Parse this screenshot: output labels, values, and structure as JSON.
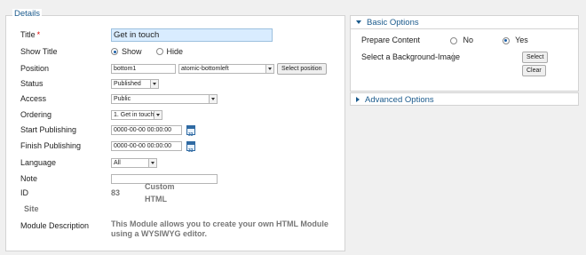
{
  "details": {
    "legend": "Details",
    "title": {
      "label": "Title",
      "required": "*",
      "value": "Get in touch"
    },
    "show_title": {
      "label": "Show Title",
      "options": [
        "Show",
        "Hide"
      ],
      "selected": "Show"
    },
    "position": {
      "label": "Position",
      "value": "bottom1",
      "select_value": "atomic-bottomleft",
      "button": "Select position"
    },
    "status": {
      "label": "Status",
      "value": "Published"
    },
    "access": {
      "label": "Access",
      "value": "Public"
    },
    "ordering": {
      "label": "Ordering",
      "value": "1. Get in touch"
    },
    "start_publishing": {
      "label": "Start Publishing",
      "value": "0000-00-00 00:00:00",
      "cal": "33"
    },
    "finish_publishing": {
      "label": "Finish Publishing",
      "value": "0000-00-00 00:00:00",
      "cal": "33"
    },
    "language": {
      "label": "Language",
      "value": "All"
    },
    "note": {
      "label": "Note",
      "value": ""
    },
    "id": {
      "label": "ID",
      "value": "83",
      "type": "Custom HTML"
    },
    "site": {
      "label": "Site"
    },
    "module_description": {
      "label": "Module Description",
      "value": "This Module allows you to create your own HTML Module using a WYSIWYG editor."
    }
  },
  "basic_options": {
    "title": "Basic Options",
    "prepare_content": {
      "label": "Prepare Content",
      "options": [
        "No",
        "Yes"
      ],
      "selected": "Yes"
    },
    "background_image": {
      "label": "Select a Background-Image",
      "select_button": "Select",
      "clear_button": "Clear"
    }
  },
  "advanced_options": {
    "title": "Advanced Options"
  },
  "colors": {
    "accent": "#1a5a8c",
    "title_field_bg": "#d9ecff",
    "required": "#dd0000"
  }
}
